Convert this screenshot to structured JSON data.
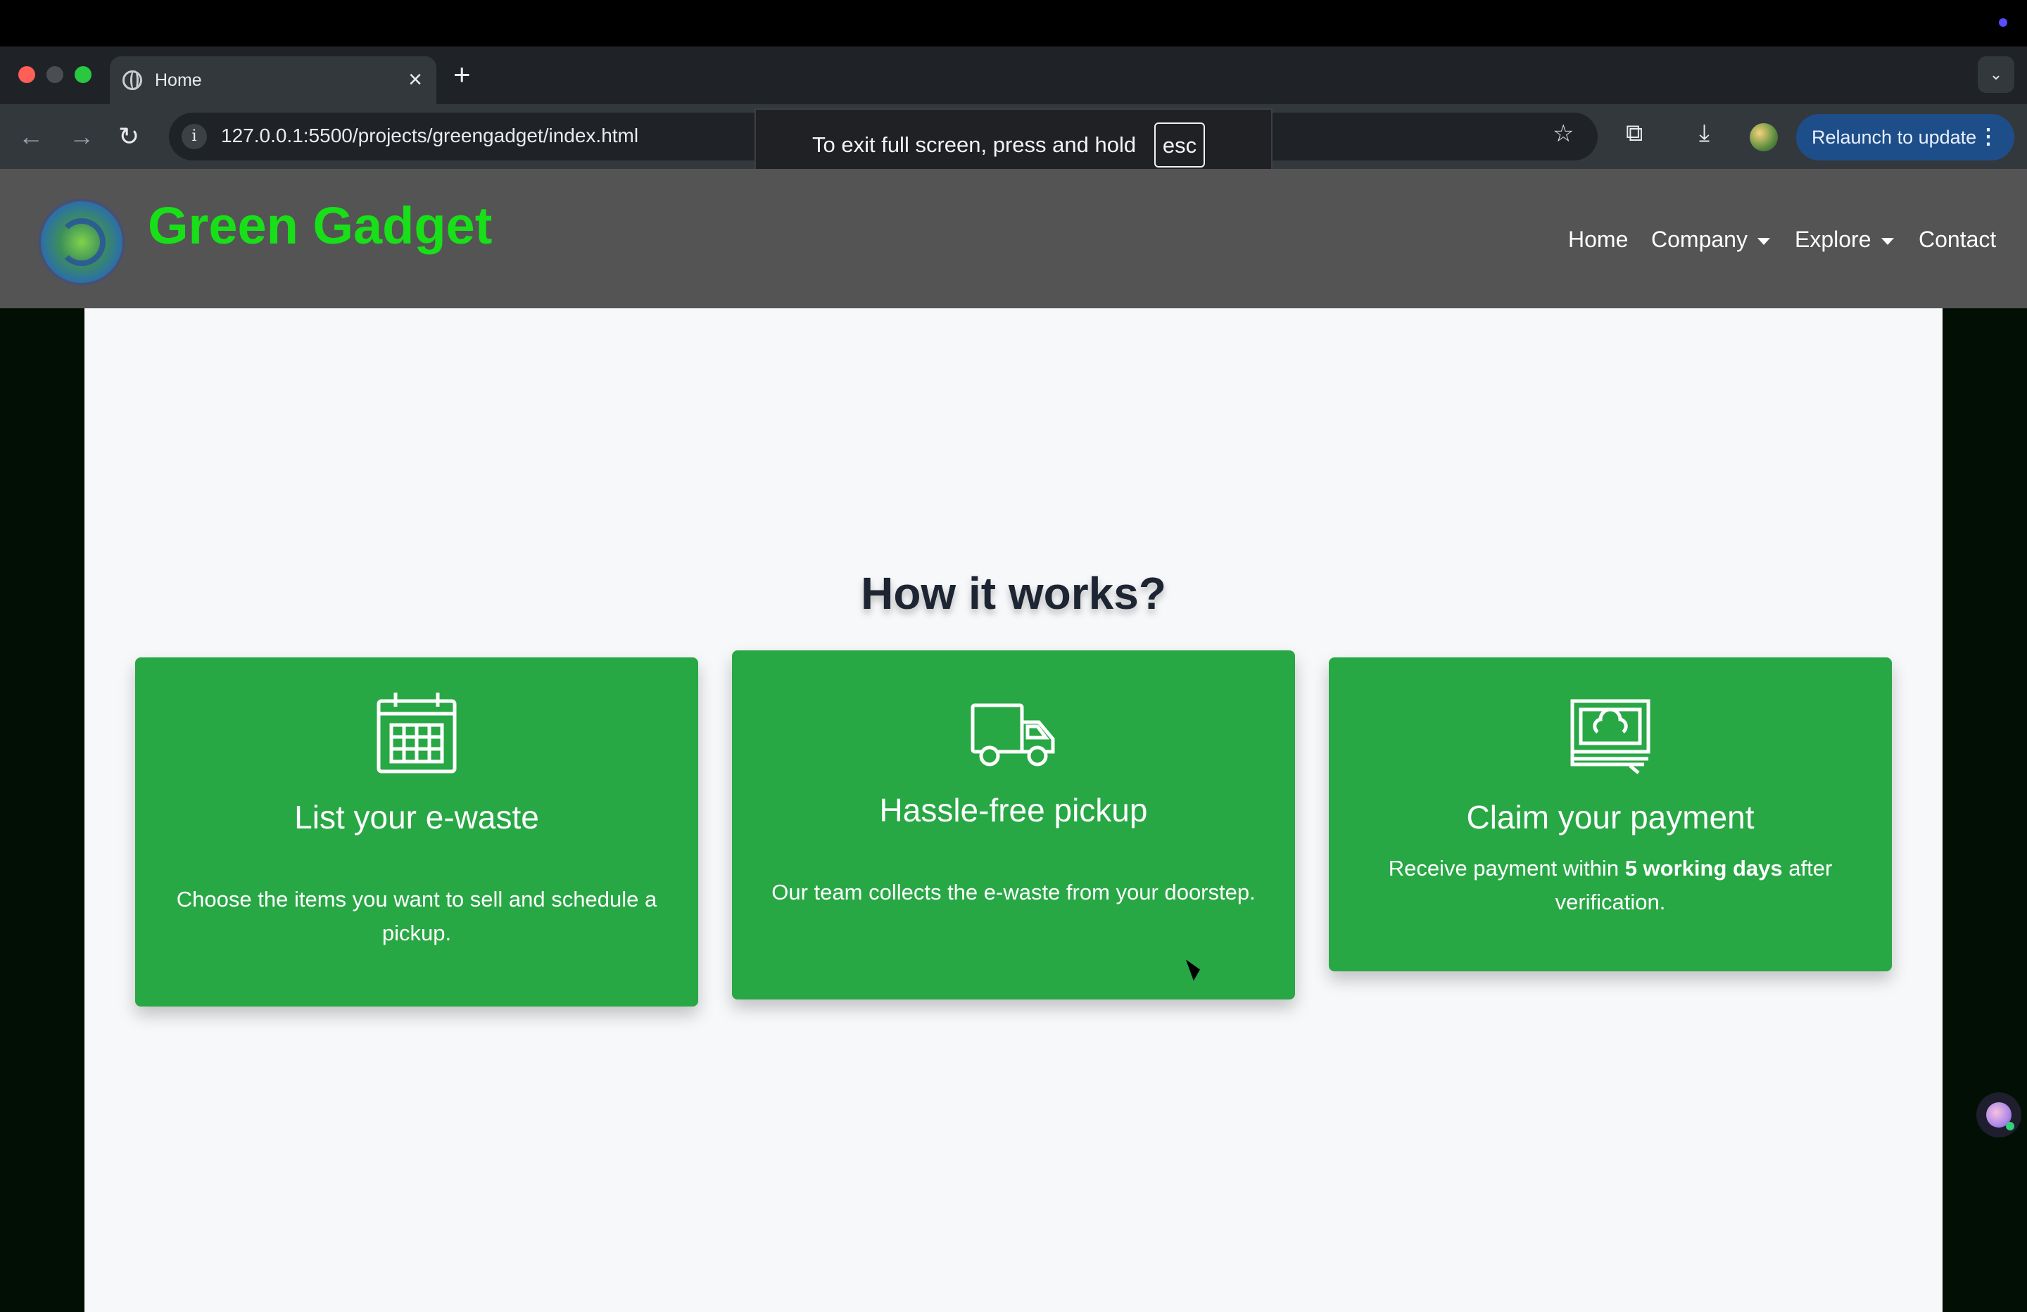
{
  "browser": {
    "tab": {
      "title": "Home",
      "favicon": "globe-icon",
      "close": "×"
    },
    "new_tab": "+",
    "tab_menu": "⌄",
    "nav": {
      "back": "←",
      "forward": "→",
      "reload": "↻"
    },
    "url": "127.0.0.1:5500/projects/greengadget/index.html",
    "relaunch_label": "Relaunch to update",
    "relaunch_menu": "⋮",
    "star": "☆",
    "extensions": "⧉",
    "download": "⤓",
    "colors": {
      "tabstrip": "#1f2327",
      "toolbar": "#33383d",
      "relaunch": "#1d4e89"
    }
  },
  "fullscreen_banner": {
    "message": "To exit full screen, press and hold",
    "key": "esc"
  },
  "site": {
    "brand": "Green Gadget",
    "nav": {
      "home": "Home",
      "company": "Company",
      "explore": "Explore",
      "contact": "Contact"
    },
    "colors": {
      "navbar": "#545454",
      "brand": "#18e018",
      "card": "#28a745",
      "page": "#f7f8fa",
      "outer": "#020f04"
    }
  },
  "section": {
    "heading": "How it works?",
    "cards": [
      {
        "icon": "calendar-icon",
        "title": "List your e-waste",
        "text": "Choose the items you want to sell and schedule a pickup."
      },
      {
        "icon": "truck-icon",
        "title": "Hassle-free pickup",
        "text": "Our team collects the e-waste from your doorstep."
      },
      {
        "icon": "money-icon",
        "title": "Claim your payment",
        "text_before": "Receive payment within ",
        "text_bold": "5 working days",
        "text_after": " after verification."
      }
    ]
  }
}
